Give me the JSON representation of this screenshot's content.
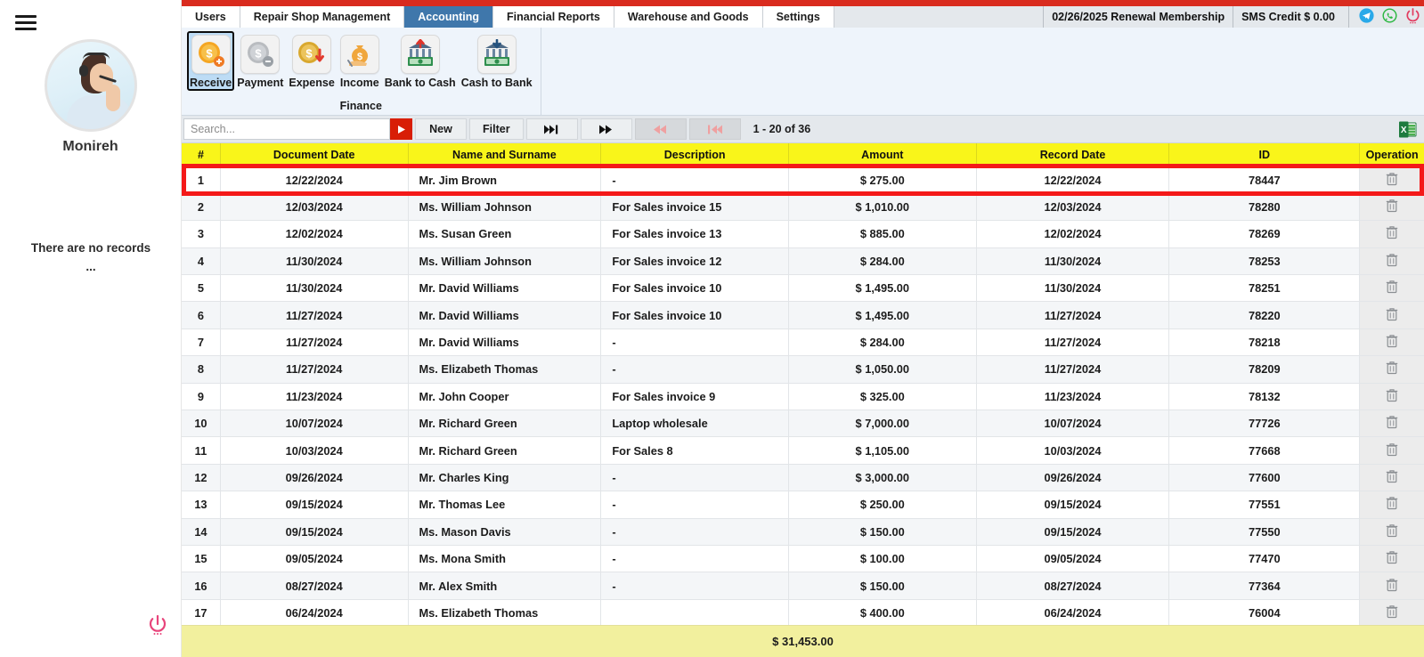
{
  "sidebar": {
    "menu_icon": "hamburger-icon",
    "avatar_icon": "user-avatar",
    "username": "Monireh",
    "empty_message_line1": "There are no records",
    "empty_message_line2": "...",
    "power_icon": "power-icon"
  },
  "header": {
    "tabs": [
      {
        "label": "Users",
        "active": false
      },
      {
        "label": "Repair Shop Management",
        "active": false
      },
      {
        "label": "Accounting",
        "active": true
      },
      {
        "label": "Financial Reports",
        "active": false
      },
      {
        "label": "Warehouse and Goods",
        "active": false
      },
      {
        "label": "Settings",
        "active": false
      }
    ],
    "membership": "02/26/2025 Renewal Membership",
    "sms_credit": "SMS Credit $ 0.00",
    "telegram_icon": "telegram-icon",
    "whatsapp_icon": "whatsapp-icon",
    "power_icon": "power-icon",
    "accent_red": "#d92b1e",
    "accent_blue": "#3f77ab"
  },
  "ribbon": {
    "group_title": "Finance",
    "items": [
      {
        "label": "Receive",
        "icon": "coin-plus-icon",
        "selected": true
      },
      {
        "label": "Payment",
        "icon": "coin-minus-icon",
        "selected": false
      },
      {
        "label": "Expense",
        "icon": "coin-down-arrow-icon",
        "selected": false
      },
      {
        "label": "Income",
        "icon": "money-bag-hand-icon",
        "selected": false
      },
      {
        "label": "Bank to Cash",
        "icon": "bank-up-arrow-icon",
        "selected": false
      },
      {
        "label": "Cash to Bank",
        "icon": "bank-down-arrow-icon",
        "selected": false
      }
    ]
  },
  "toolbar": {
    "search_placeholder": "Search...",
    "search_value": "",
    "go_label": "▶",
    "new_label": "New",
    "filter_label": "Filter",
    "next_page_icon": "skip-next-icon",
    "fast_forward_icon": "fast-forward-icon",
    "rewind_icon": "rewind-icon",
    "first_page_icon": "skip-first-icon",
    "range_label": "1 - 20 of 36",
    "excel_icon": "excel-export-icon"
  },
  "table": {
    "columns": [
      "#",
      "Document Date",
      "Name and Surname",
      "Description",
      "Amount",
      "Record Date",
      "ID",
      "Operation"
    ],
    "delete_icon": "trash-icon",
    "rows": [
      {
        "num": "1",
        "doc_date": "12/22/2024",
        "name": "Mr. Jim Brown",
        "description": "-",
        "amount": "$ 275.00",
        "record_date": "12/22/2024",
        "id": "78447",
        "highlighted": true
      },
      {
        "num": "2",
        "doc_date": "12/03/2024",
        "name": "Ms. William Johnson",
        "description": "For Sales invoice 15",
        "amount": "$ 1,010.00",
        "record_date": "12/03/2024",
        "id": "78280",
        "highlighted": false
      },
      {
        "num": "3",
        "doc_date": "12/02/2024",
        "name": "Ms. Susan Green",
        "description": "For Sales invoice 13",
        "amount": "$ 885.00",
        "record_date": "12/02/2024",
        "id": "78269",
        "highlighted": false
      },
      {
        "num": "4",
        "doc_date": "11/30/2024",
        "name": "Ms. William Johnson",
        "description": "For Sales invoice 12",
        "amount": "$ 284.00",
        "record_date": "11/30/2024",
        "id": "78253",
        "highlighted": false
      },
      {
        "num": "5",
        "doc_date": "11/30/2024",
        "name": "Mr. David Williams",
        "description": "For Sales invoice 10",
        "amount": "$ 1,495.00",
        "record_date": "11/30/2024",
        "id": "78251",
        "highlighted": false
      },
      {
        "num": "6",
        "doc_date": "11/27/2024",
        "name": "Mr. David Williams",
        "description": "For Sales invoice 10",
        "amount": "$ 1,495.00",
        "record_date": "11/27/2024",
        "id": "78220",
        "highlighted": false
      },
      {
        "num": "7",
        "doc_date": "11/27/2024",
        "name": "Mr. David Williams",
        "description": "-",
        "amount": "$ 284.00",
        "record_date": "11/27/2024",
        "id": "78218",
        "highlighted": false
      },
      {
        "num": "8",
        "doc_date": "11/27/2024",
        "name": "Ms. Elizabeth Thomas",
        "description": "-",
        "amount": "$ 1,050.00",
        "record_date": "11/27/2024",
        "id": "78209",
        "highlighted": false
      },
      {
        "num": "9",
        "doc_date": "11/23/2024",
        "name": "Mr. John Cooper",
        "description": "For Sales invoice 9",
        "amount": "$ 325.00",
        "record_date": "11/23/2024",
        "id": "78132",
        "highlighted": false
      },
      {
        "num": "10",
        "doc_date": "10/07/2024",
        "name": "Mr. Richard Green",
        "description": "Laptop wholesale",
        "amount": "$ 7,000.00",
        "record_date": "10/07/2024",
        "id": "77726",
        "highlighted": false
      },
      {
        "num": "11",
        "doc_date": "10/03/2024",
        "name": "Mr. Richard Green",
        "description": "For Sales 8",
        "amount": "$ 1,105.00",
        "record_date": "10/03/2024",
        "id": "77668",
        "highlighted": false
      },
      {
        "num": "12",
        "doc_date": "09/26/2024",
        "name": "Mr. Charles King",
        "description": "-",
        "amount": "$ 3,000.00",
        "record_date": "09/26/2024",
        "id": "77600",
        "highlighted": false
      },
      {
        "num": "13",
        "doc_date": "09/15/2024",
        "name": "Mr. Thomas Lee",
        "description": "-",
        "amount": "$ 250.00",
        "record_date": "09/15/2024",
        "id": "77551",
        "highlighted": false
      },
      {
        "num": "14",
        "doc_date": "09/15/2024",
        "name": "Ms. Mason Davis",
        "description": "-",
        "amount": "$ 150.00",
        "record_date": "09/15/2024",
        "id": "77550",
        "highlighted": false
      },
      {
        "num": "15",
        "doc_date": "09/05/2024",
        "name": "Ms. Mona Smith",
        "description": "-",
        "amount": "$ 100.00",
        "record_date": "09/05/2024",
        "id": "77470",
        "highlighted": false
      },
      {
        "num": "16",
        "doc_date": "08/27/2024",
        "name": "Mr. Alex Smith",
        "description": "-",
        "amount": "$ 150.00",
        "record_date": "08/27/2024",
        "id": "77364",
        "highlighted": false
      },
      {
        "num": "17",
        "doc_date": "06/24/2024",
        "name": "Ms. Elizabeth Thomas",
        "description": "",
        "amount": "$ 400.00",
        "record_date": "06/24/2024",
        "id": "76004",
        "highlighted": false
      }
    ]
  },
  "footer": {
    "total": "$ 31,453.00"
  }
}
